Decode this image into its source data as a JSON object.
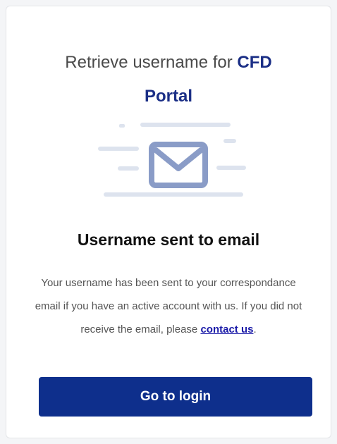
{
  "header": {
    "title_prefix": "Retrieve username for",
    "brand_line1": "CFD",
    "brand_line2": "Portal"
  },
  "illustration": {
    "icon": "envelope-icon",
    "accent_color": "#8a9cc7"
  },
  "main": {
    "title": "Username sent to email",
    "message_before_link": "Your username has been sent to your correspondance email if you have an active account with us. If you did not receive the email, please",
    "link_label": "contact us",
    "message_after_link": "."
  },
  "actions": {
    "login_button_label": "Go to login",
    "primary_color": "#0e2f8c"
  }
}
